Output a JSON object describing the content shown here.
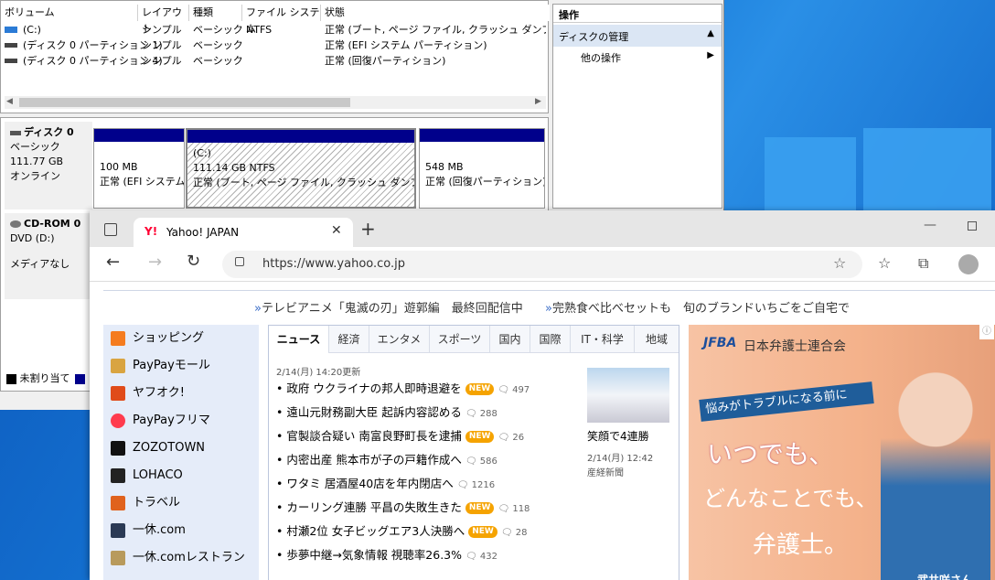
{
  "disk_mgmt": {
    "columns": [
      "ボリューム",
      "レイアウト",
      "種類",
      "ファイル システム",
      "状態"
    ],
    "volumes": [
      {
        "name": "(C:)",
        "layout": "シンプル",
        "type": "ベーシック",
        "fs": "NTFS",
        "status": "正常 (ブート, ページ ファイル, クラッシュ ダンプ, ベーシ"
      },
      {
        "name": "(ディスク 0 パーティション 1)",
        "layout": "シンプル",
        "type": "ベーシック",
        "fs": "",
        "status": "正常 (EFI システム パーティション)"
      },
      {
        "name": "(ディスク 0 パーティション 4)",
        "layout": "シンプル",
        "type": "ベーシック",
        "fs": "",
        "status": "正常 (回復パーティション)"
      }
    ],
    "ops": {
      "header": "操作",
      "section": "ディスクの管理",
      "item": "他の操作"
    },
    "disk0": {
      "name": "ディスク 0",
      "type": "ベーシック",
      "size": "111.77 GB",
      "state": "オンライン",
      "parts": [
        {
          "size": "100 MB",
          "status": "正常 (EFI システム"
        },
        {
          "label": "(C:)",
          "size": "111.14 GB NTFS",
          "status": "正常 (ブート, ページ ファイル, クラッシュ ダンプ, ベーシ"
        },
        {
          "size": "548 MB",
          "status": "正常 (回復パーティション)"
        }
      ]
    },
    "cdrom": {
      "name": "CD-ROM 0",
      "drive": "DVD (D:)",
      "media": "メディアなし"
    },
    "legend": {
      "unalloc": "未割り当て"
    }
  },
  "browser": {
    "tab_title": "Yahoo! JAPAN",
    "url": "https://www.yahoo.co.jp",
    "promo": [
      "テレビアニメ「鬼滅の刃」遊郭編　最終回配信中",
      "完熟食べ比べセットも　旬のブランドいちごをご自宅で"
    ],
    "services": [
      "ショッピング",
      "PayPayモール",
      "ヤフオク!",
      "PayPayフリマ",
      "ZOZOTOWN",
      "LOHACO",
      "トラベル",
      "一休.com",
      "一休.comレストラン"
    ],
    "news_tabs": [
      "ニュース",
      "経済",
      "エンタメ",
      "スポーツ",
      "国内",
      "国際",
      "IT・科学",
      "地域"
    ],
    "updated": "2/14(月) 14:20更新",
    "news": [
      {
        "title": "政府 ウクライナの邦人即時退避を",
        "new": "NEW",
        "comments": "497"
      },
      {
        "title": "遠山元財務副大臣 起訴内容認める",
        "new": "",
        "comments": "288"
      },
      {
        "title": "官製談合疑い 南富良野町長を逮捕",
        "new": "NEW",
        "comments": "26"
      },
      {
        "title": "内密出産 熊本市が子の戸籍作成へ",
        "new": "",
        "comments": "586"
      },
      {
        "title": "ワタミ 居酒屋40店を年内閉店へ",
        "new": "",
        "comments": "1216"
      },
      {
        "title": "カーリング連勝 平昌の失敗生きた",
        "new": "NEW",
        "comments": "118"
      },
      {
        "title": "村瀬2位 女子ビッグエア3人決勝へ",
        "new": "NEW",
        "comments": "28"
      },
      {
        "title": "歩夢中継→気象情報 視聴率26.3%",
        "new": "",
        "comments": "432"
      }
    ],
    "pickup": {
      "caption": "笑顔で4連勝",
      "date": "2/14(月) 12:42",
      "source": "産経新聞"
    },
    "ad": {
      "org": "日本弁護士連合会",
      "logo": "JFBA",
      "band": "悩みがトラブルになる前に",
      "line1": "いつでも、",
      "line2": "どんなことでも、",
      "line3": "弁護士。",
      "person": "武井咲さん"
    }
  }
}
